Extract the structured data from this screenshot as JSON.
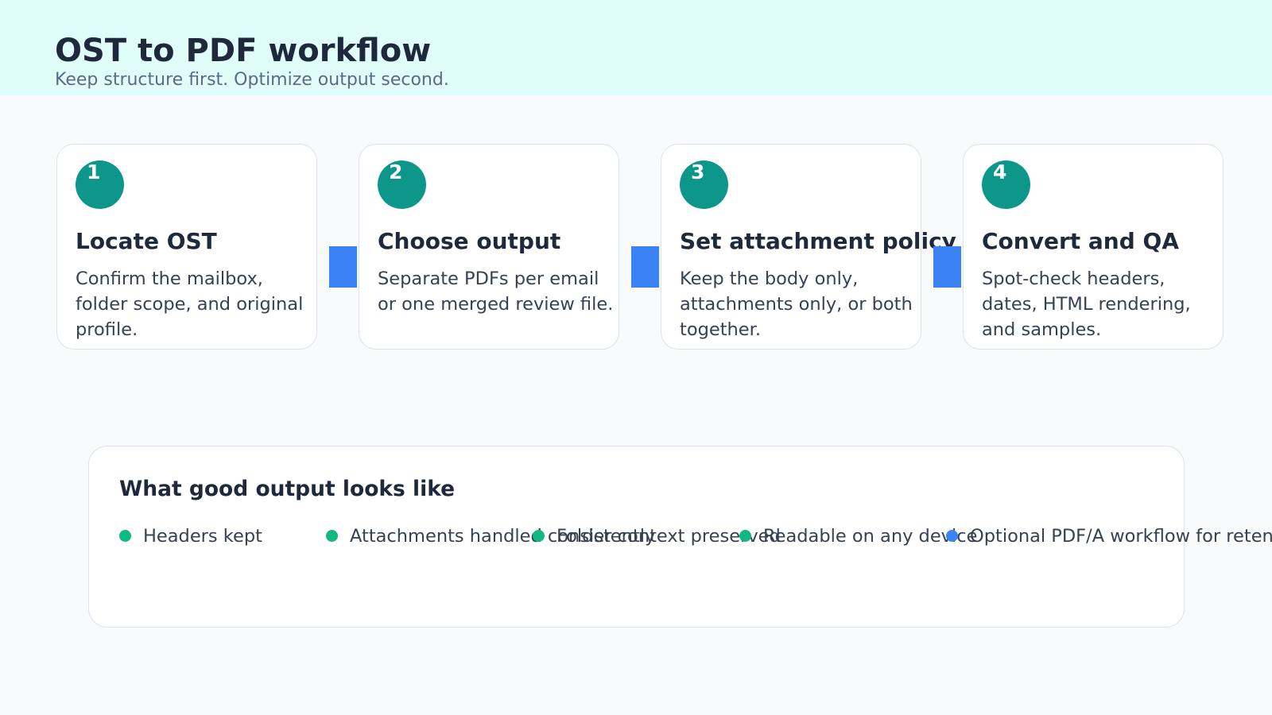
{
  "header": {
    "title": "OST to PDF workflow",
    "subtitle": "Keep structure first. Optimize output second."
  },
  "steps": [
    {
      "number": "1",
      "title": "Locate OST",
      "description": "Confirm the mailbox, folder scope, and original profile."
    },
    {
      "number": "2",
      "title": "Choose output",
      "description": "Separate PDFs per email or one merged review file."
    },
    {
      "number": "3",
      "title": "Set attachment policy",
      "description": "Keep the body only, attachments only, or both together."
    },
    {
      "number": "4",
      "title": "Convert and QA",
      "description": "Spot-check headers, dates, HTML rendering, and samples."
    }
  ],
  "good_output": {
    "title": "What good output looks like",
    "items": [
      {
        "label": "Headers kept",
        "dot_color": "#10b981"
      },
      {
        "label": "Attachments handled consistently",
        "dot_color": "#10b981"
      },
      {
        "label": "Folder context preserved",
        "dot_color": "#10b981"
      },
      {
        "label": "Readable on any device",
        "dot_color": "#10b981"
      },
      {
        "label": "Optional PDF/A workflow for retention",
        "dot_color": "#3b82f6"
      }
    ]
  },
  "colors": {
    "header_band": "#e0fdf9",
    "badge": "#0d968a",
    "connector": "#3b82f6",
    "check_dot": "#10b981",
    "optional_dot": "#3b82f6"
  }
}
